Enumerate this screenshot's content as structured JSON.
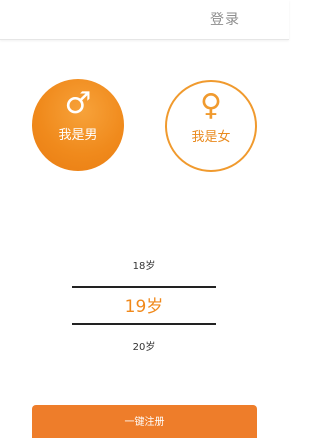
{
  "header": {
    "login_label": "登录"
  },
  "gender": {
    "male": {
      "symbol": "♂",
      "label": "我是男",
      "selected": true
    },
    "female": {
      "symbol": "♀",
      "label": "我是女",
      "selected": false
    }
  },
  "age_picker": {
    "prev": "18岁",
    "current": "19岁",
    "next": "20岁"
  },
  "register": {
    "label": "一键注册"
  },
  "colors": {
    "accent": "#f08a1c",
    "button": "#ee7d2a",
    "text_muted": "#8e8e8e"
  }
}
